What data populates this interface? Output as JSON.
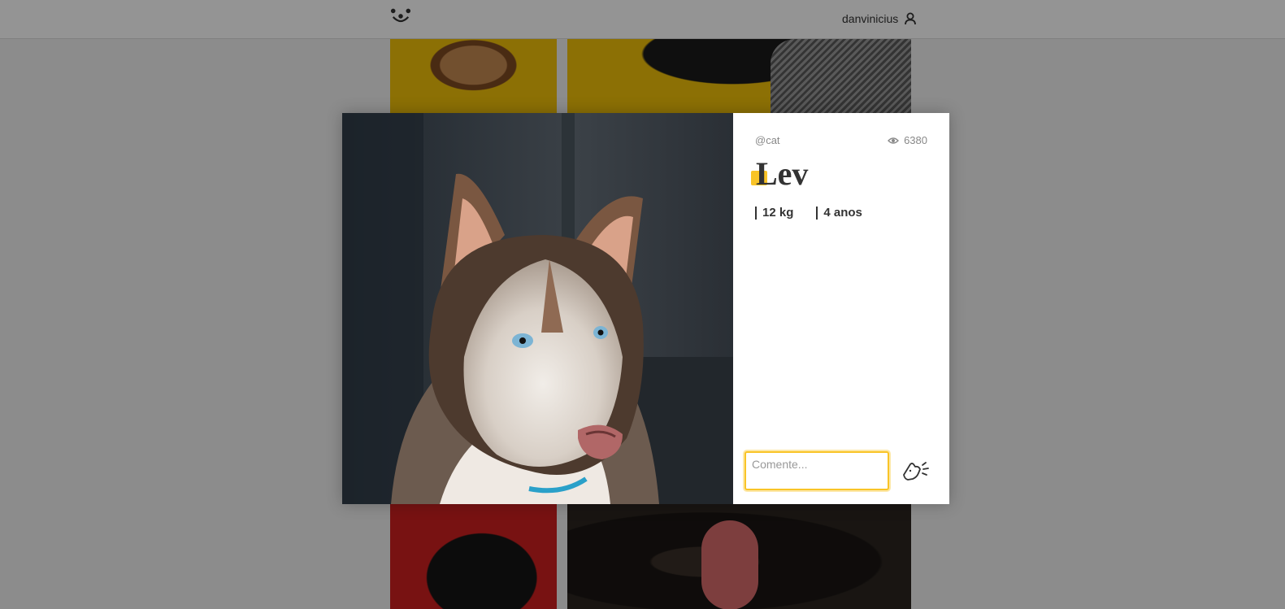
{
  "header": {
    "username": "danvinicius",
    "logo_icon": "dog-face-icon",
    "user_icon": "user-icon"
  },
  "photo": {
    "author": "@cat",
    "views": "6380",
    "title": "Lev",
    "weight": "12 kg",
    "age": "4 anos"
  },
  "comment": {
    "placeholder": "Comente...",
    "send_icon": "dog-bark-send-icon"
  },
  "colors": {
    "accent": "#fb1",
    "focus": "#f9c427",
    "overlay": "rgba(0,0,0,0.42)"
  }
}
